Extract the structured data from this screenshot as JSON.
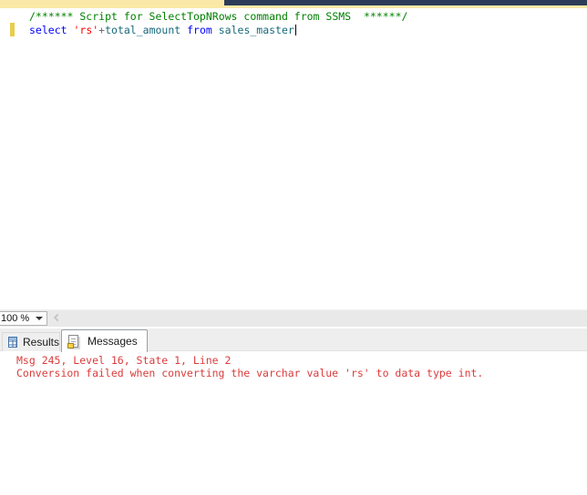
{
  "colors": {
    "tab_band_yellow": "#fae9a6",
    "tab_band_navy": "#2c3c58",
    "comment_green": "#008000",
    "keyword_blue": "#0000ff",
    "string_red": "#ff0000",
    "identifier_teal": "#17697a",
    "change_bar_yellow": "#e9cd4d",
    "error_red": "#dc3b3b"
  },
  "editor": {
    "comment_line": "/****** Script for SelectTopNRows command from SSMS  ******/",
    "query": {
      "select_keyword": "select ",
      "string_literal": "'rs'",
      "plus_operator": "+",
      "column_name": "total_amount",
      "from_keyword": " from ",
      "table_name": "sales_master"
    }
  },
  "status_bar": {
    "zoom_level": "100 %"
  },
  "results_tabs": [
    {
      "label": "Results"
    },
    {
      "label": "Messages",
      "active": true
    }
  ],
  "messages_pane": {
    "error_header": "Msg 245, Level 16, State 1, Line 2",
    "error_detail": "Conversion failed when converting the varchar value 'rs' to data type int."
  }
}
